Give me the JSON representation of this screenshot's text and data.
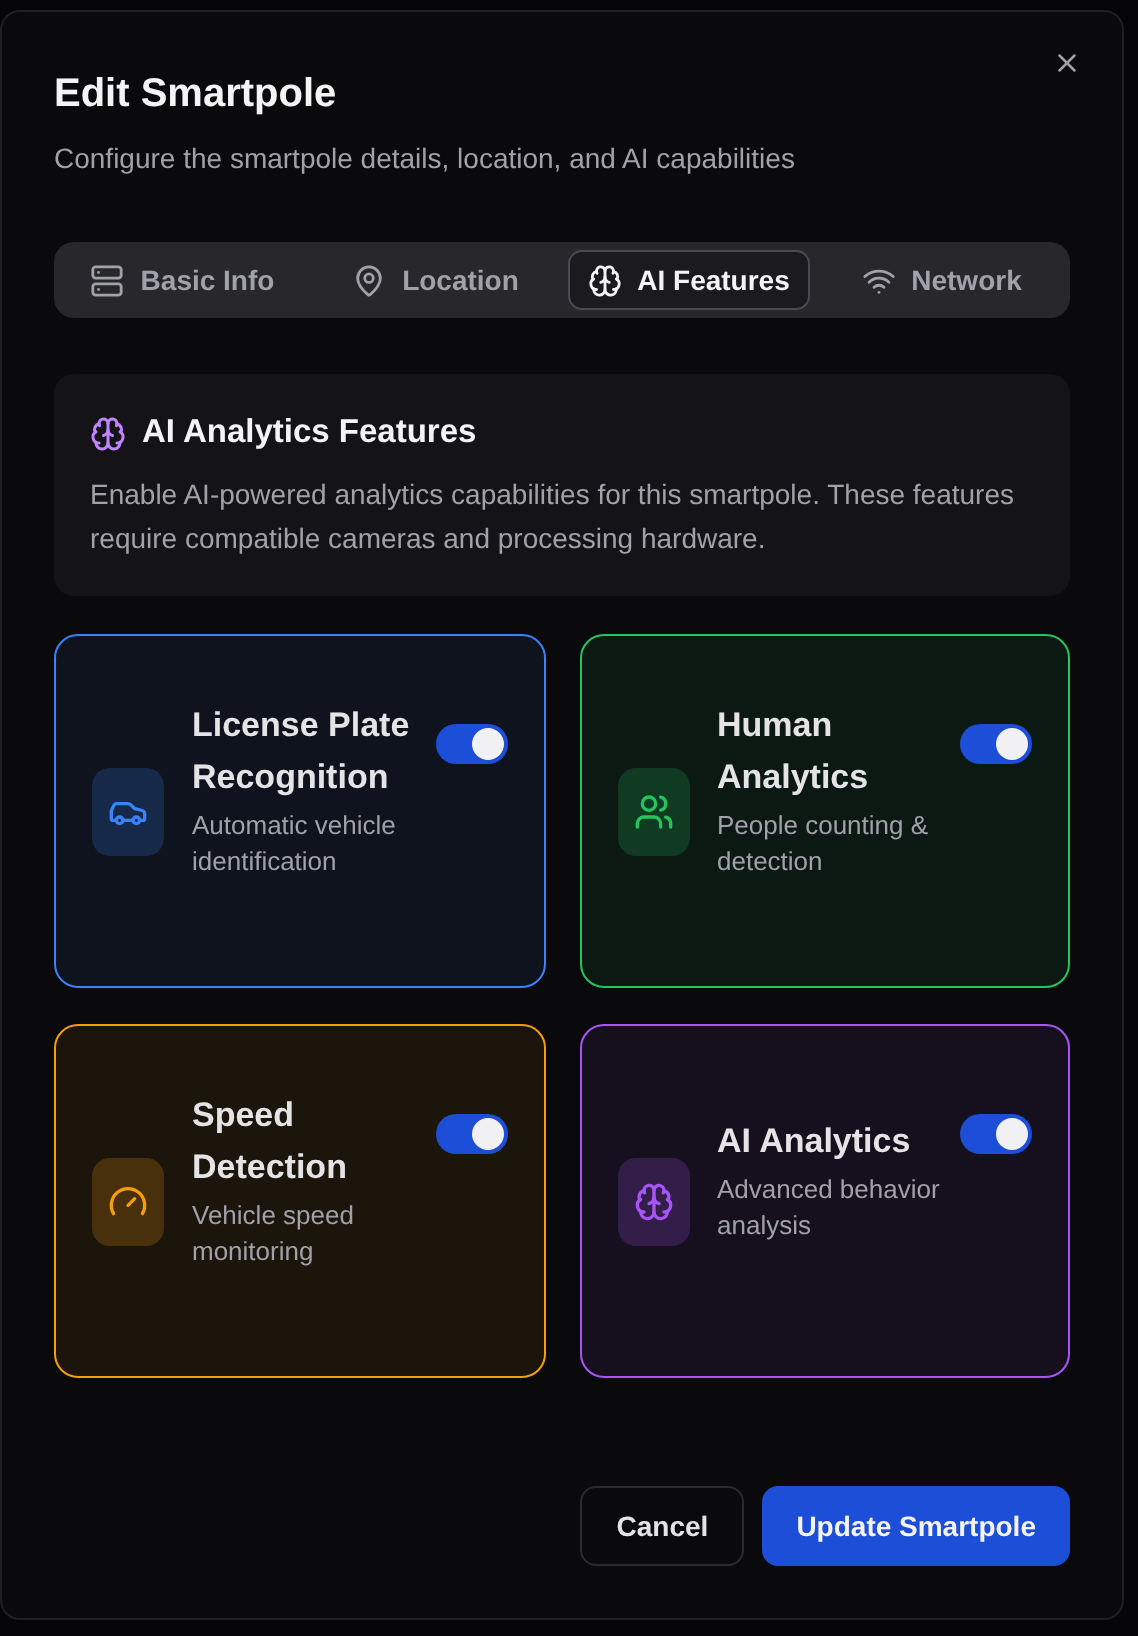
{
  "dialog": {
    "title": "Edit Smartpole",
    "description": "Configure the smartpole details, location, and AI capabilities"
  },
  "tabs": [
    {
      "label": "Basic Info",
      "kind": "server",
      "selected": false
    },
    {
      "label": "Location",
      "kind": "pin",
      "selected": false
    },
    {
      "label": "AI Features",
      "kind": "brain",
      "selected": true
    },
    {
      "label": "Network",
      "kind": "wifi",
      "selected": false
    }
  ],
  "info": {
    "title": "AI Analytics Features",
    "text": "Enable AI-powered analytics capabilities for this smartpole. These features require compatible cameras and processing hardware."
  },
  "features": [
    {
      "title": "License Plate Recognition",
      "description": "Automatic vehicle identification",
      "kind": "car",
      "color": "#3b82f6",
      "on": true
    },
    {
      "title": "Human Analytics",
      "description": "People counting & detection",
      "kind": "users",
      "color": "#22c55e",
      "on": true
    },
    {
      "title": "Speed Detection",
      "description": "Vehicle speed monitoring",
      "kind": "gauge",
      "color": "#f59e0b",
      "on": true
    },
    {
      "title": "AI Analytics",
      "description": "Advanced behavior analysis",
      "kind": "brain",
      "color": "#a855f7",
      "on": true
    }
  ],
  "buttons": {
    "cancel": "Cancel",
    "submit": "Update Smartpole"
  }
}
